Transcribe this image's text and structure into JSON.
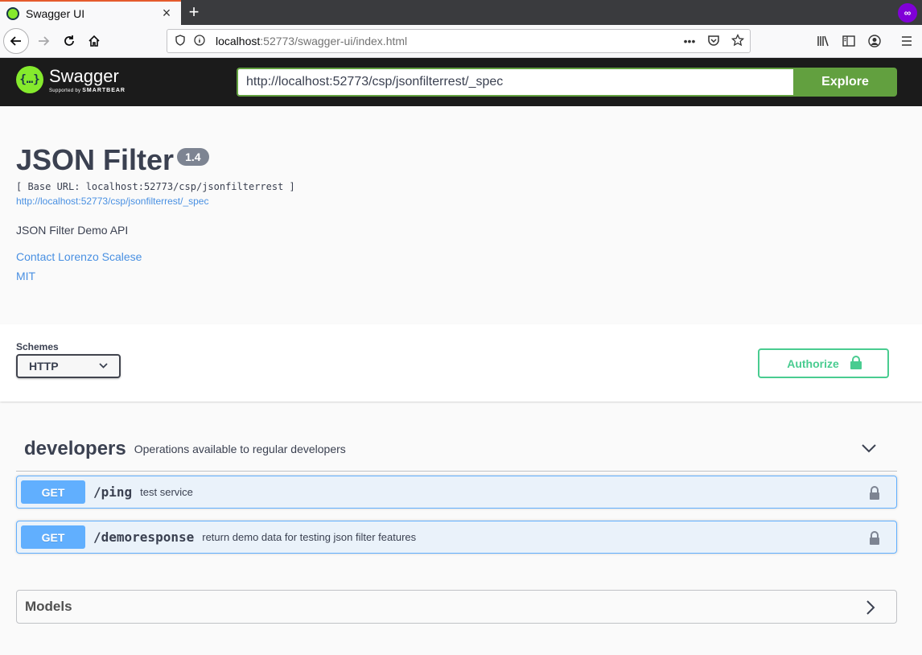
{
  "browser": {
    "tab_title": "Swagger UI",
    "tab_close": "×",
    "new_tab": "+",
    "url_host": "localhost",
    "url_rest": ":52773/swagger-ui/index.html",
    "page_actions": "•••"
  },
  "topbar": {
    "logo_mark": "{…}",
    "logo_name": "Swagger",
    "logo_sub_prefix": "Supported by ",
    "logo_sub_brand": "SMARTBEAR",
    "spec_url": "http://localhost:52773/csp/jsonfilterrest/_spec",
    "explore_label": "Explore"
  },
  "info": {
    "title": "JSON Filter",
    "version": "1.4",
    "base_url": "[ Base URL: localhost:52773/csp/jsonfilterrest ]",
    "spec_link": "http://localhost:52773/csp/jsonfilterrest/_spec",
    "description": "JSON Filter Demo API",
    "contact": "Contact Lorenzo Scalese",
    "license": "MIT"
  },
  "schemes": {
    "label": "Schemes",
    "selected": "HTTP",
    "authorize_label": "Authorize"
  },
  "tag": {
    "name": "developers",
    "description": "Operations available to regular developers"
  },
  "operations": [
    {
      "method": "GET",
      "path": "/ping",
      "summary": "test service"
    },
    {
      "method": "GET",
      "path": "/demoresponse",
      "summary": "return demo data for testing json filter features"
    }
  ],
  "models": {
    "title": "Models"
  },
  "colors": {
    "get": "#61affe",
    "accent_green": "#62a03f",
    "authorize_green": "#49cc90"
  }
}
